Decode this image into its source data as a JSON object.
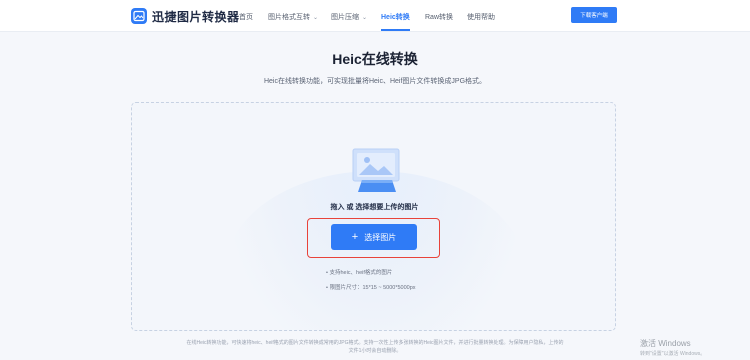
{
  "header": {
    "brand": "迅捷图片转换器",
    "nav": [
      {
        "label": "首页",
        "has_dropdown": false,
        "active": false
      },
      {
        "label": "图片格式互转",
        "has_dropdown": true,
        "active": false
      },
      {
        "label": "图片压缩",
        "has_dropdown": true,
        "active": false
      },
      {
        "label": "Heic转换",
        "has_dropdown": false,
        "active": true
      },
      {
        "label": "Raw转换",
        "has_dropdown": false,
        "active": false
      },
      {
        "label": "使用帮助",
        "has_dropdown": false,
        "active": false
      }
    ],
    "download_label": "下载客户端"
  },
  "main": {
    "title": "Heic在线转换",
    "subtitle": "Heic在线转换功能，可实现批量将Heic、Heif图片文件转换成JPG格式。",
    "dropzone": {
      "hint": "拖入 或 选择想要上传的图片",
      "button_label": "选择图片",
      "notes": [
        "• 支持heic、heif格式的图片",
        "• 限图片尺寸：15*15 ~ 5000*5000px"
      ]
    },
    "footer_lines": [
      "在线Heic转换功能，可快速将heic、heif格式的图片文件转换成常用的JPG格式。支持一次性上传多张转换的Heic图片文件，并进行批量转换处理。为保障用户隐私，上传的",
      "文件1小时会自动删除。"
    ]
  },
  "os_watermark": {
    "title": "激活 Windows",
    "subtitle": "转到\"设置\"以激活 Windows。"
  },
  "colors": {
    "accent": "#2f7bf6",
    "highlight_border": "#e8433a",
    "dropzone_bg": "#f3f6fb"
  }
}
